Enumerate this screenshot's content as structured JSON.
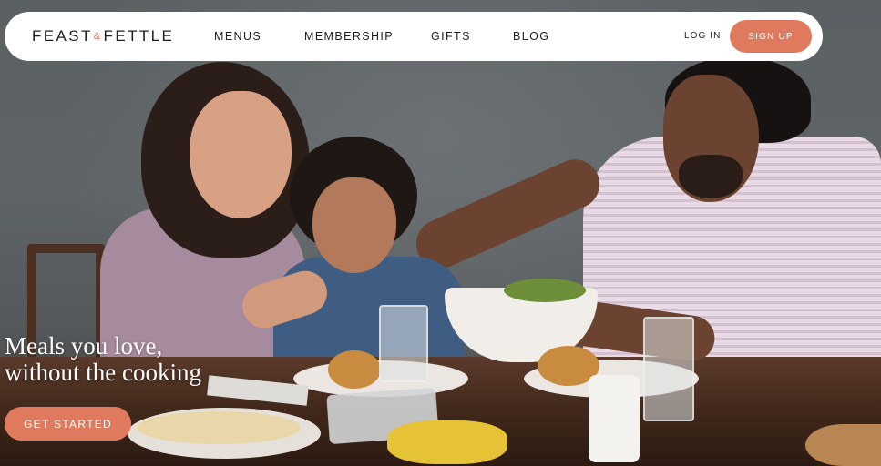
{
  "header": {
    "logo": {
      "left": "FEAST",
      "amp": "&",
      "right": "FETTLE"
    },
    "nav": {
      "menus": "MENUS",
      "membership": "MEMBERSHIP",
      "gifts": "GIFTS",
      "blog": "BLOG"
    },
    "login": "LOG IN",
    "signup": "SIGN UP"
  },
  "hero": {
    "title_line1": "Meals you love,",
    "title_line2": "without the cooking",
    "cta": "GET STARTED",
    "image_icon": "family-dinner-photo"
  },
  "colors": {
    "accent": "#e07a5f",
    "nav_background": "#ffffff",
    "text_dark": "#1f1f1f"
  }
}
